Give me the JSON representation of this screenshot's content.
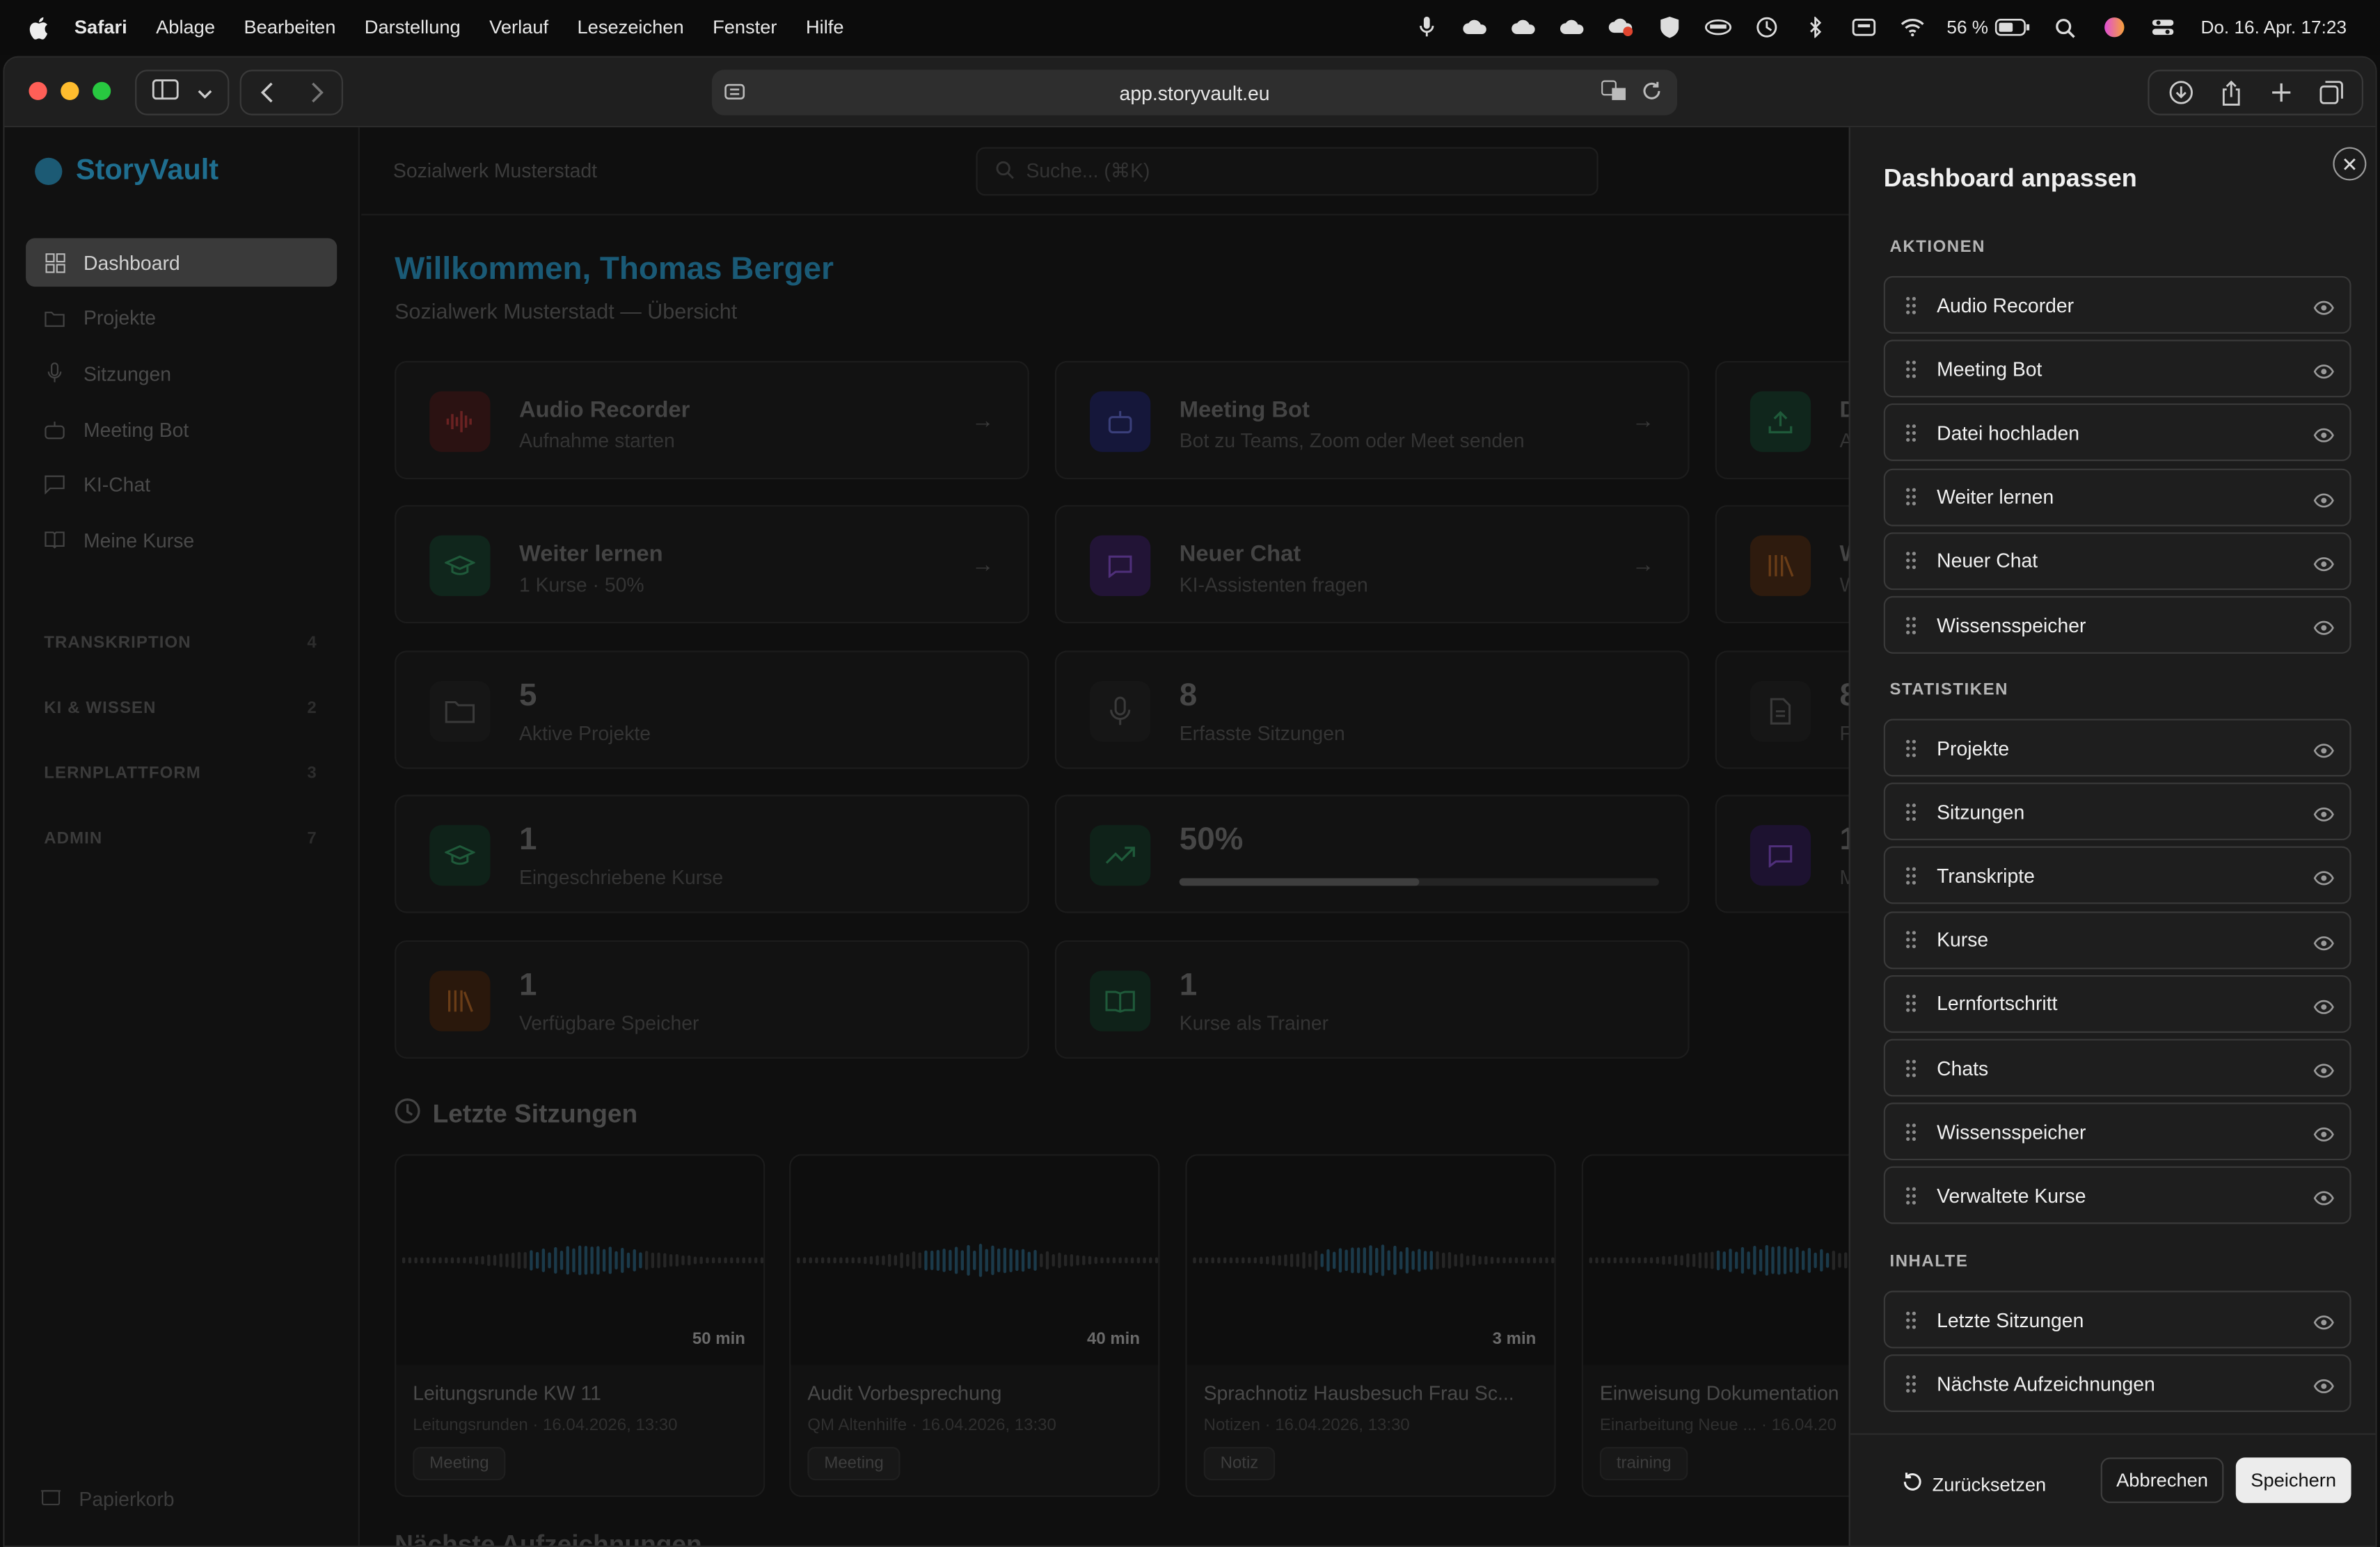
{
  "menubar": {
    "app": "Safari",
    "items": [
      "Ablage",
      "Bearbeiten",
      "Darstellung",
      "Verlauf",
      "Lesezeichen",
      "Fenster",
      "Hilfe"
    ],
    "battery": "56 %",
    "clock": "Do. 16. Apr.  17:23"
  },
  "browser": {
    "url": "app.storyvault.eu"
  },
  "app": {
    "brand": "StoryVault",
    "org": "Sozialwerk Musterstadt",
    "search_placeholder": "Suche... (⌘K)",
    "nav": [
      {
        "label": "Dashboard",
        "icon": "grid-icon"
      },
      {
        "label": "Projekte",
        "icon": "folder-icon"
      },
      {
        "label": "Sitzungen",
        "icon": "mic-icon"
      },
      {
        "label": "Meeting Bot",
        "icon": "bot-icon"
      },
      {
        "label": "KI-Chat",
        "icon": "chat-icon"
      },
      {
        "label": "Meine Kurse",
        "icon": "book-icon"
      }
    ],
    "sections": [
      {
        "label": "TRANSKRIPTION",
        "count": "4"
      },
      {
        "label": "KI & WISSEN",
        "count": "2"
      },
      {
        "label": "LERNPLATTFORM",
        "count": "3"
      },
      {
        "label": "ADMIN",
        "count": "7"
      }
    ],
    "trash": "Papierkorb",
    "welcome": "Willkommen, Thomas Berger",
    "welcome_sub": "Sozialwerk Musterstadt — Übersicht",
    "actions": [
      {
        "title": "Audio Recorder",
        "sub": "Aufnahme starten",
        "icon": "waveform-icon",
        "color": "#3a1414"
      },
      {
        "title": "Meeting Bot",
        "sub": "Bot zu Teams, Zoom oder Meet senden",
        "icon": "bot-icon",
        "color": "#16183a"
      },
      {
        "title": "Weiter lernen",
        "sub": "1 Kurse · 50%",
        "icon": "graduation-icon",
        "color": "#10261c"
      },
      {
        "title": "Neuer Chat",
        "sub": "KI-Assistenten fragen",
        "icon": "chat-icon",
        "color": "#221436"
      }
    ],
    "stats": [
      {
        "num": "5",
        "label": "Aktive Projekte",
        "icon": "folder-icon"
      },
      {
        "num": "8",
        "label": "Erfasste Sitzungen",
        "icon": "mic-icon"
      },
      {
        "num": "1",
        "label": "Eingeschriebene Kurse",
        "icon": "graduation-icon"
      },
      {
        "num": "50%",
        "label": "",
        "icon": "trend-icon",
        "progress": 0.5
      },
      {
        "num": "1",
        "label": "Verfügbare Speicher",
        "icon": "library-icon"
      },
      {
        "num": "1",
        "label": "Kurse als Trainer",
        "icon": "open-book-icon"
      }
    ],
    "partial_cards": [
      {
        "t": "D",
        "s": "A"
      },
      {
        "t": "W",
        "s": "W"
      },
      {
        "t": "8",
        "s": "F"
      },
      {
        "t": "1",
        "s": "M"
      }
    ],
    "recent_title": "Letzte Sitzungen",
    "sessions": [
      {
        "dur": "50 min",
        "title": "Leitungsrunde KW 11",
        "meta": "Leitungsrunden  ·  16.04.2026, 13:30",
        "tag": "Meeting"
      },
      {
        "dur": "40 min",
        "title": "Audit Vorbesprechung",
        "meta": "QM Altenhilfe  ·  16.04.2026, 13:30",
        "tag": "Meeting"
      },
      {
        "dur": "3 min",
        "title": "Sprachnotiz Hausbesuch Frau Sc...",
        "meta": "Notizen  ·  16.04.2026, 13:30",
        "tag": "Notiz"
      },
      {
        "dur": "",
        "title": "Einweisung Dokumentation",
        "meta": "Einarbeitung Neue ...  ·  16.04.20",
        "tag": "training"
      }
    ],
    "next_title": "Nächste Aufzeichnungen"
  },
  "panel": {
    "title": "Dashboard anpassen",
    "groups": [
      {
        "label": "AKTIONEN",
        "items": [
          "Audio Recorder",
          "Meeting Bot",
          "Datei hochladen",
          "Weiter lernen",
          "Neuer Chat",
          "Wissensspeicher"
        ]
      },
      {
        "label": "STATISTIKEN",
        "items": [
          "Projekte",
          "Sitzungen",
          "Transkripte",
          "Kurse",
          "Lernfortschritt",
          "Chats",
          "Wissensspeicher",
          "Verwaltete Kurse"
        ]
      },
      {
        "label": "INHALTE",
        "items": [
          "Letzte Sitzungen",
          "Nächste Aufzeichnungen"
        ]
      }
    ],
    "reset": "Zurücksetzen",
    "cancel": "Abbrechen",
    "save": "Speichern"
  }
}
